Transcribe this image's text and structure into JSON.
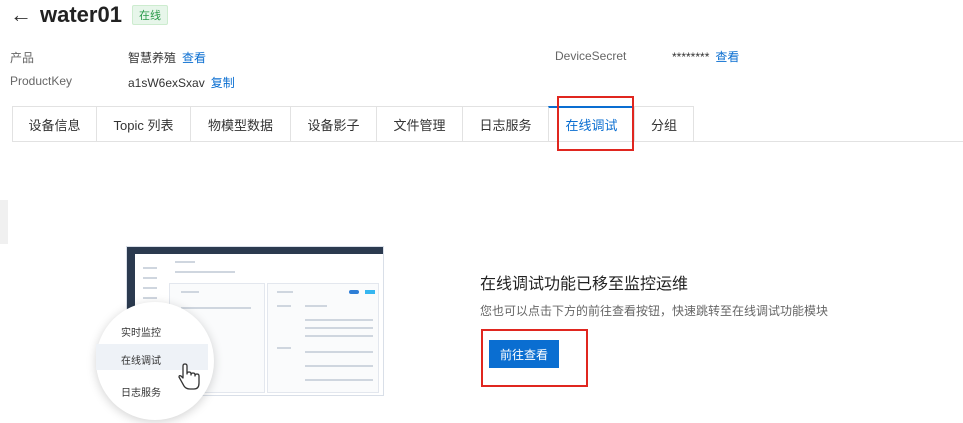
{
  "header": {
    "back_icon": "back-arrow-icon",
    "back_glyph": "←",
    "device_name": "water01",
    "status": "在线",
    "status_color": "#2b9a4a"
  },
  "meta": {
    "product_label": "产品",
    "product_value": "智慧养殖",
    "product_link": "查看",
    "productkey_label": "ProductKey",
    "productkey_value": "a1sW6exSxav",
    "productkey_link": "复制",
    "secret_label": "DeviceSecret",
    "secret_value": "********",
    "secret_link": "查看"
  },
  "tabs": [
    {
      "label": "设备信息"
    },
    {
      "label": "Topic 列表"
    },
    {
      "label": "物模型数据"
    },
    {
      "label": "设备影子"
    },
    {
      "label": "文件管理"
    },
    {
      "label": "日志服务"
    },
    {
      "label": "在线调试",
      "active": true
    },
    {
      "label": "分组"
    }
  ],
  "illustration": {
    "menu_items": [
      "实时监控",
      "在线调试",
      "日志服务"
    ],
    "cursor_icon": "hand-pointer-icon"
  },
  "promo": {
    "title": "在线调试功能已移至监控运维",
    "description": "您也可以点击下方的前往查看按钮，快速跳转至在线调试功能模块",
    "button_label": "前往查看"
  },
  "colors": {
    "accent": "#0a6ed1",
    "highlight": "#e0261f",
    "success": "#2b9a4a"
  }
}
